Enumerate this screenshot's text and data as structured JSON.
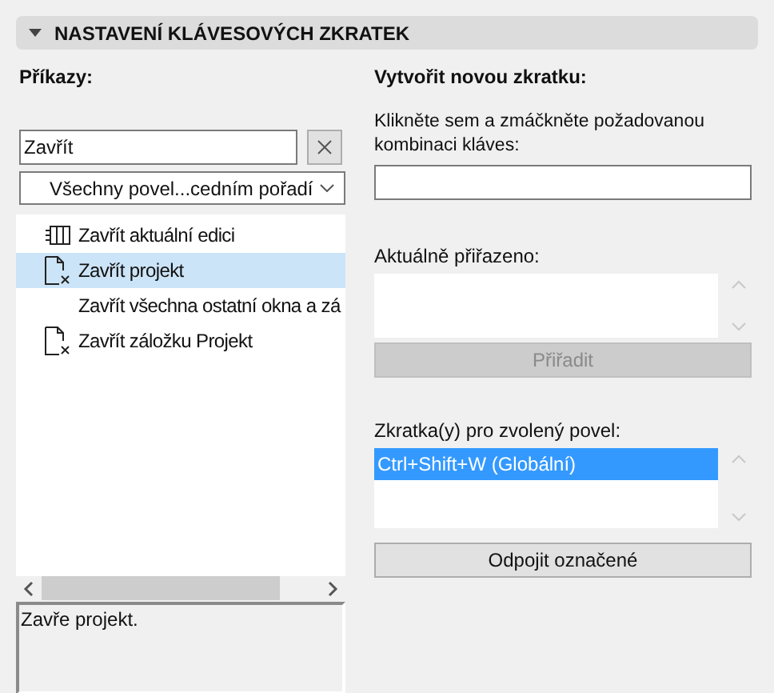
{
  "section": {
    "title": "NASTAVENÍ KLÁVESOVÝCH ZKRATEK",
    "expanded": true
  },
  "commands": {
    "label": "Příkazy:",
    "search": {
      "value": "Zavřít"
    },
    "filter": {
      "value": "Všechny povel...cedním pořadí"
    },
    "items": [
      {
        "kind": "edition",
        "label": "Zavřít aktuální edici",
        "selected": false
      },
      {
        "kind": "document",
        "label": "Zavřít projekt",
        "selected": true
      },
      {
        "kind": "none",
        "label": "Zavřít všechna ostatní okna a zá",
        "selected": false
      },
      {
        "kind": "document",
        "label": "Zavřít záložku Projekt",
        "selected": false
      }
    ],
    "description": "Zavře projekt."
  },
  "new_shortcut": {
    "title": "Vytvořit novou zkratku:",
    "prompt": "Klikněte sem a zmáčkněte požadovanou kombinaci kláves:",
    "assigned_label": "Aktuálně přiřazeno:",
    "assign_button": {
      "label": "Přiřadit",
      "disabled": true
    }
  },
  "current": {
    "label": "Zkratka(y) pro zvolený povel:",
    "items": [
      {
        "label": "Ctrl+Shift+W (Globální)",
        "selected": true
      }
    ],
    "detach_button": {
      "label": "Odpojit označené",
      "disabled": false
    }
  }
}
